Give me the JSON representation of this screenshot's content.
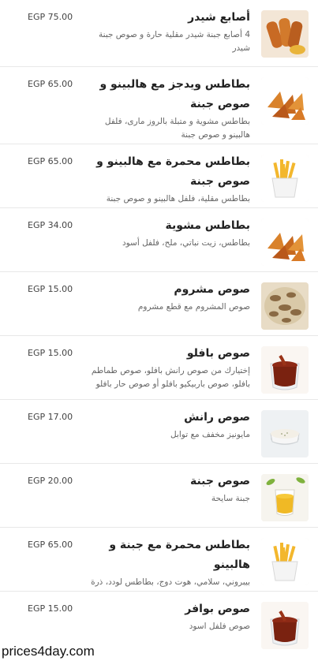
{
  "menu": {
    "items": [
      {
        "title": "أصابع شيدر",
        "description": "4 أصابع جبنة شيدر مقلية حارة و صوص جبنة شيدر",
        "price": "EGP 75.00",
        "image": "cheddar-fingers"
      },
      {
        "title": "بطاطس ويدجز مع هالبينو و صوص جبنة",
        "description": "بطاطس مشوية و متبلة بالروز مارى، فلفل هالبينو و صوص جبنة",
        "price": "EGP 65.00",
        "image": "wedges"
      },
      {
        "title": "بطاطس محمرة مع هالبينو و صوص جبنة",
        "description": "بطاطس مقلية، فلفل هالبينو و صوص جبنة",
        "price": "EGP 65.00",
        "image": "fries"
      },
      {
        "title": "بطاطس مشوية",
        "description": "بطاطس، زيت نباتي، ملح، فلفل أسود",
        "price": "EGP 34.00",
        "image": "wedges"
      },
      {
        "title": "صوص مشروم",
        "description": "صوص المشروم مع قطع مشروم",
        "price": "EGP 15.00",
        "image": "mushroom-sauce"
      },
      {
        "title": "صوص بافلو",
        "description": "إختيارك من صوص رانش بافلو، صوص طماطم بافلو، صوص باربيكيو بافلو أو صوص حار بافلو",
        "price": "EGP 15.00",
        "image": "bbq-sauce"
      },
      {
        "title": "صوص رانش",
        "description": "مايونيز مخفف مع توابل",
        "price": "EGP 17.00",
        "image": "ranch-sauce"
      },
      {
        "title": "صوص جبنة",
        "description": "جبنة سايحة",
        "price": "EGP 20.00",
        "image": "cheese-sauce"
      },
      {
        "title": "بطاطس محمرة مع جبنة و هالبينو",
        "description": "بيبروني، سلامي، هوت دوج، بطاطس لودد، ذرة صفراء، جبنة و صوص فلفل حلو",
        "price": "EGP 65.00",
        "image": "fries"
      },
      {
        "title": "صوص بوافر",
        "description": "صوص فلفل اسود",
        "price": "EGP 15.00",
        "image": "bbq-sauce"
      }
    ]
  },
  "watermark": "prices4day.com"
}
